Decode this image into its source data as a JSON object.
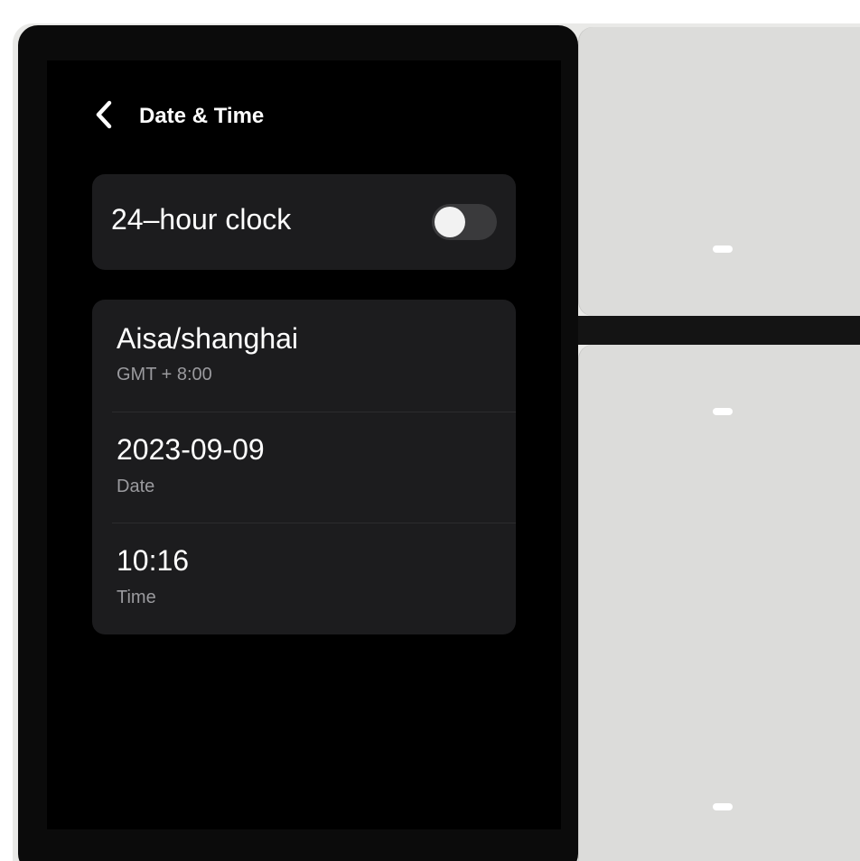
{
  "header": {
    "title": "Date & Time",
    "back_icon": "chevron-left-icon"
  },
  "clock_setting": {
    "label": "24–hour clock",
    "enabled": false
  },
  "time_settings": {
    "items": [
      {
        "value": "Aisa/shanghai",
        "subtitle": "GMT + 8:00"
      },
      {
        "value": "2023-09-09",
        "subtitle": "Date"
      },
      {
        "value": "10:16",
        "subtitle": "Time"
      }
    ]
  },
  "colors": {
    "screen_bg": "#000000",
    "card_bg": "#1c1c1e",
    "panel_bg": "#dcdcda",
    "toggle_off_track": "#3a3a3c"
  }
}
